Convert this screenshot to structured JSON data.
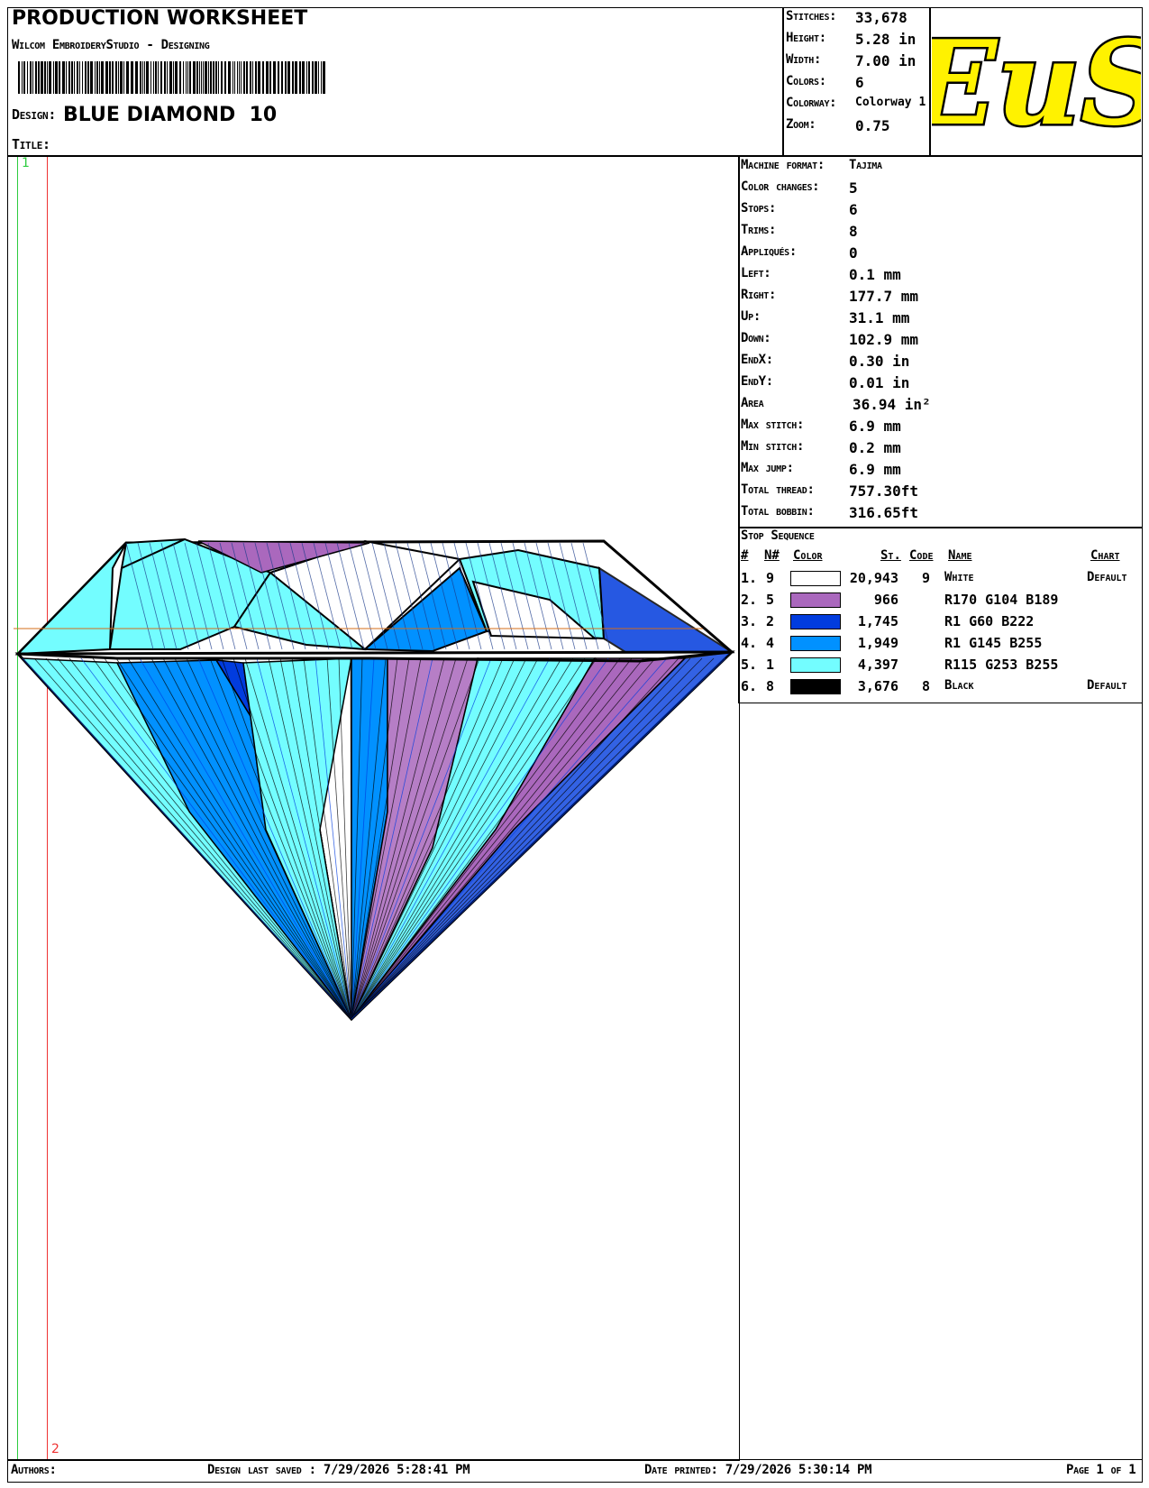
{
  "header": {
    "title": "PRODUCTION WORKSHEET",
    "subtitle": "Wilcom EmbroideryStudio - Designing",
    "design_label": "Design:",
    "design_name": "BLUE DIAMOND  10",
    "title_label": "Title:"
  },
  "summary": [
    {
      "label": "Stitches:",
      "value": "33,678"
    },
    {
      "label": "Height:",
      "value": "5.28 in"
    },
    {
      "label": "Width:",
      "value": "7.00 in"
    },
    {
      "label": "Colors:",
      "value": "6"
    },
    {
      "label": "Colorway:",
      "value": "Colorway 1"
    },
    {
      "label": "Zoom:",
      "value": "0.75"
    }
  ],
  "logo": {
    "text": "EuS",
    "colors": {
      "fill": "#FFF200",
      "stroke": "#000000"
    }
  },
  "stats": [
    {
      "label": "Machine format:",
      "value": "Tajima"
    },
    {
      "label": "Color changes:",
      "value": "5"
    },
    {
      "label": "Stops:",
      "value": "6"
    },
    {
      "label": "Trims:",
      "value": "8"
    },
    {
      "label": "Appliqués:",
      "value": "0"
    },
    {
      "label": "Left:",
      "value": "0.1 mm"
    },
    {
      "label": "Right:",
      "value": "177.7 mm"
    },
    {
      "label": "Up:",
      "value": "31.1 mm"
    },
    {
      "label": "Down:",
      "value": "102.9 mm"
    },
    {
      "label": "EndX:",
      "value": "0.30 in"
    },
    {
      "label": "EndY:",
      "value": "0.01 in"
    },
    {
      "label": "Area",
      "value": "36.94 in²"
    },
    {
      "label": "Max stitch:",
      "value": "6.9 mm"
    },
    {
      "label": "Min stitch:",
      "value": "0.2 mm"
    },
    {
      "label": "Max jump:",
      "value": "6.9 mm"
    },
    {
      "label": "Total thread:",
      "value": "757.30ft"
    },
    {
      "label": "Total bobbin:",
      "value": "316.65ft"
    }
  ],
  "stop_sequence": {
    "title": "Stop Sequence",
    "headers": [
      "#",
      "N#",
      "Color",
      "St.",
      "Code",
      "Name",
      "Chart"
    ],
    "rows": [
      {
        "num": "1.",
        "n": "9",
        "color": "#FFFFFF",
        "st": "20,943",
        "code": "9",
        "name": "White",
        "chart": "Default"
      },
      {
        "num": "2.",
        "n": "5",
        "color": "#AA68BD",
        "st": "966",
        "code": "",
        "name": "R170 G104 B189",
        "chart": ""
      },
      {
        "num": "3.",
        "n": "2",
        "color": "#013CDE",
        "st": "1,745",
        "code": "",
        "name": "R1 G60 B222",
        "chart": ""
      },
      {
        "num": "4.",
        "n": "4",
        "color": "#0191FF",
        "st": "1,949",
        "code": "",
        "name": "R1 G145 B255",
        "chart": ""
      },
      {
        "num": "5.",
        "n": "1",
        "color": "#73FDFF",
        "st": "4,397",
        "code": "",
        "name": "R115 G253 B255",
        "chart": ""
      },
      {
        "num": "6.",
        "n": "8",
        "color": "#000000",
        "st": "3,676",
        "code": "8",
        "name": "Black",
        "chart": "Default"
      }
    ]
  },
  "guides": {
    "left_label": "1",
    "right_label": "2"
  },
  "footer": {
    "authors": "Authors:",
    "saved": "Design last saved : 7/29/2026 5:28:41 PM",
    "printed": "Date printed: 7/29/2026 5:30:14 PM",
    "page": "Page 1 of 1"
  }
}
